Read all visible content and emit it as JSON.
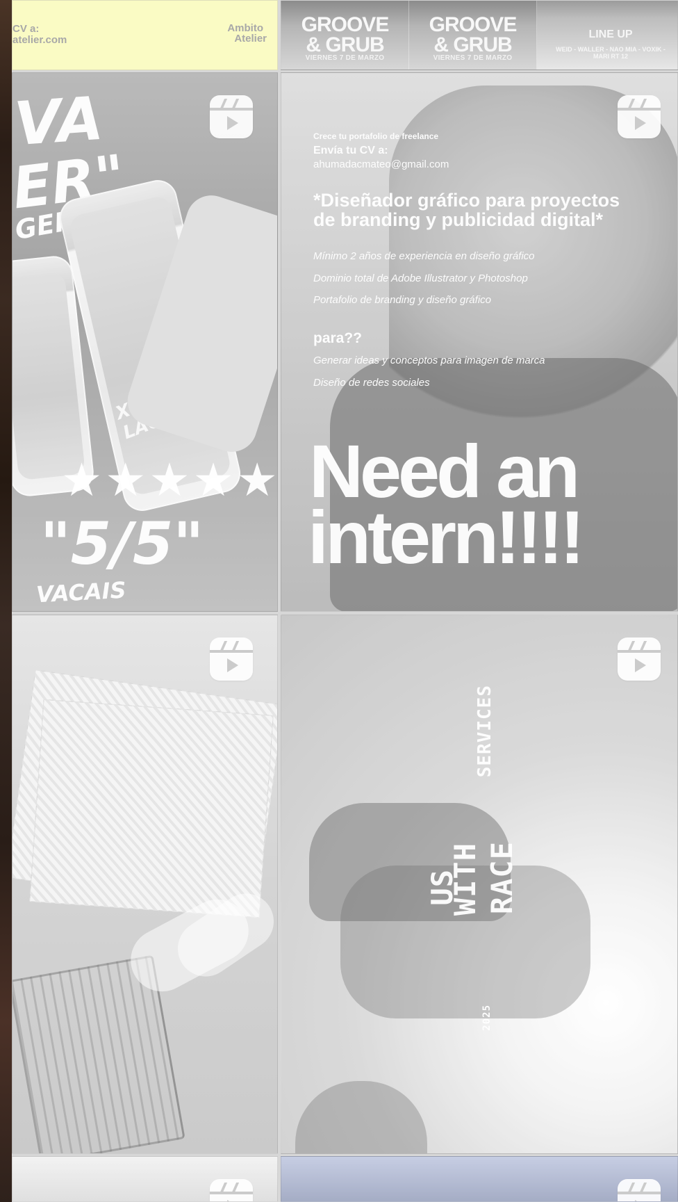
{
  "feed": {
    "top_left": {
      "line1": "CV a:",
      "line2": "atelier.com",
      "brand_line1": "Ambito",
      "brand_line2": "Atelier"
    },
    "top_right": {
      "card_title_1": "GROOVE",
      "card_title_2": "& GRUB",
      "card_date": "VIERNES 7 DE MARZO",
      "lineup_title": "LINE UP",
      "lineup_names": "WEID - WALLER - NAO MIA - VOXIK - MARI RT 12"
    },
    "beer": {
      "word1": "VA",
      "word2": "ER\"",
      "word3": "GERTO",
      "can_text": "XICAN LAGER",
      "stars": "★★★★★",
      "rating": "\"5/5\"",
      "bottom": "VACAIS"
    },
    "intern": {
      "intro": "Crece tu portafolio de freelance",
      "cta": "Envía tu CV a:",
      "email": "ahumadacmateo@gmail.com",
      "role_1": "*Diseñador gráfico para proyectos",
      "role_2": "de branding y publicidad digital*",
      "req_1": "Mínimo 2 años de experiencia en diseño gráfico",
      "req_2": "Dominio total de Adobe Illustrator y Photoshop",
      "req_3": "Portafolio de branding y diseño gráfico",
      "para": "para??",
      "task_1": "Generar ideas y conceptos para imagen de marca",
      "task_2": "Diseño de redes sociales",
      "headline_1": "Need an",
      "headline_2": "intern!!!!"
    },
    "blur": {
      "vertical_1": "SERVICES",
      "vertical_2": "RACE",
      "vertical_3": "WITH",
      "vertical_4": "US",
      "vertical_5": "2025"
    }
  }
}
